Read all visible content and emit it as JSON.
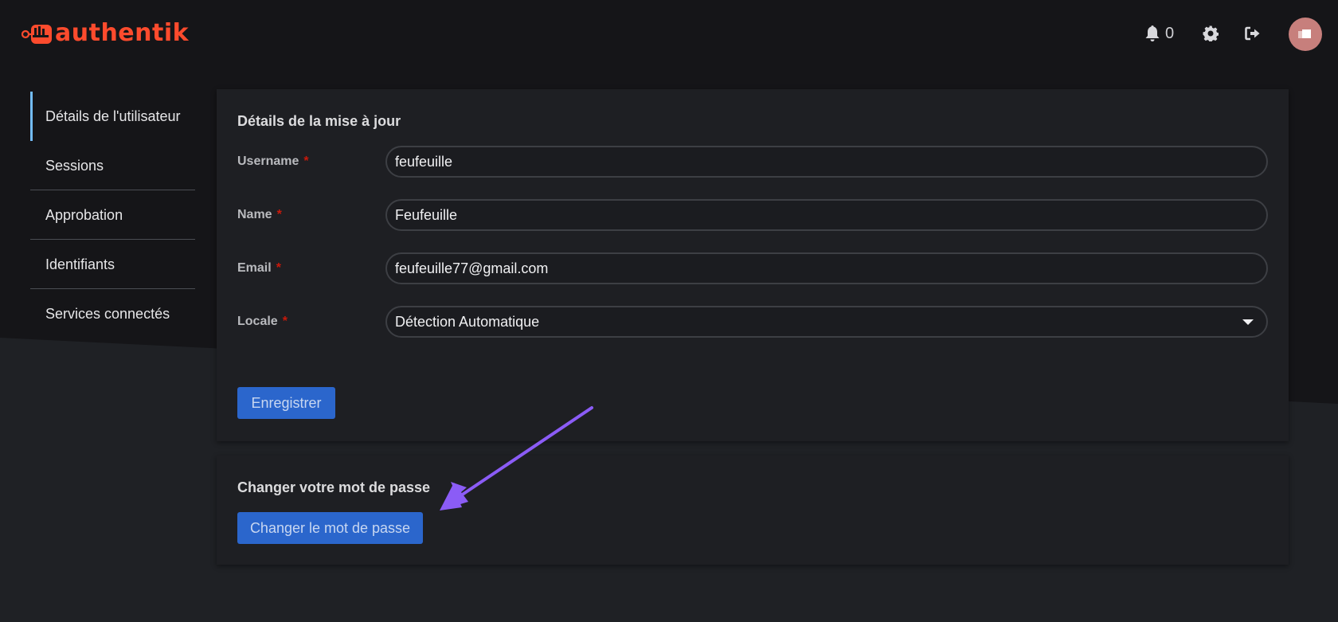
{
  "app": {
    "brand": "authentik"
  },
  "header": {
    "notifications_count": "0",
    "icons": [
      "bell-icon",
      "gear-icon",
      "sign-out-icon"
    ]
  },
  "sidebar": {
    "items": [
      {
        "label": "Détails de l'utilisateur",
        "active": true
      },
      {
        "label": "Sessions"
      },
      {
        "label": "Approbation"
      },
      {
        "label": "Identifiants"
      },
      {
        "label": "Services connectés"
      }
    ]
  },
  "details": {
    "title": "Détails de la mise à jour",
    "username": {
      "label": "Username",
      "required_mark": "*",
      "value": "feufeuille"
    },
    "name": {
      "label": "Name",
      "required_mark": "*",
      "value": "Feufeuille"
    },
    "email": {
      "label": "Email",
      "required_mark": "*",
      "value": "feufeuille77@gmail.com"
    },
    "locale": {
      "label": "Locale",
      "required_mark": "*",
      "value": "Détection Automatique"
    },
    "save_label": "Enregistrer"
  },
  "password": {
    "title": "Changer votre mot de passe",
    "button_label": "Changer le mot de passe"
  },
  "colors": {
    "brand": "#fd4b2d",
    "primary_button": "#2b66cc",
    "annotation_arrow": "#8b5cf6",
    "active_nav": "#73bcf7"
  }
}
